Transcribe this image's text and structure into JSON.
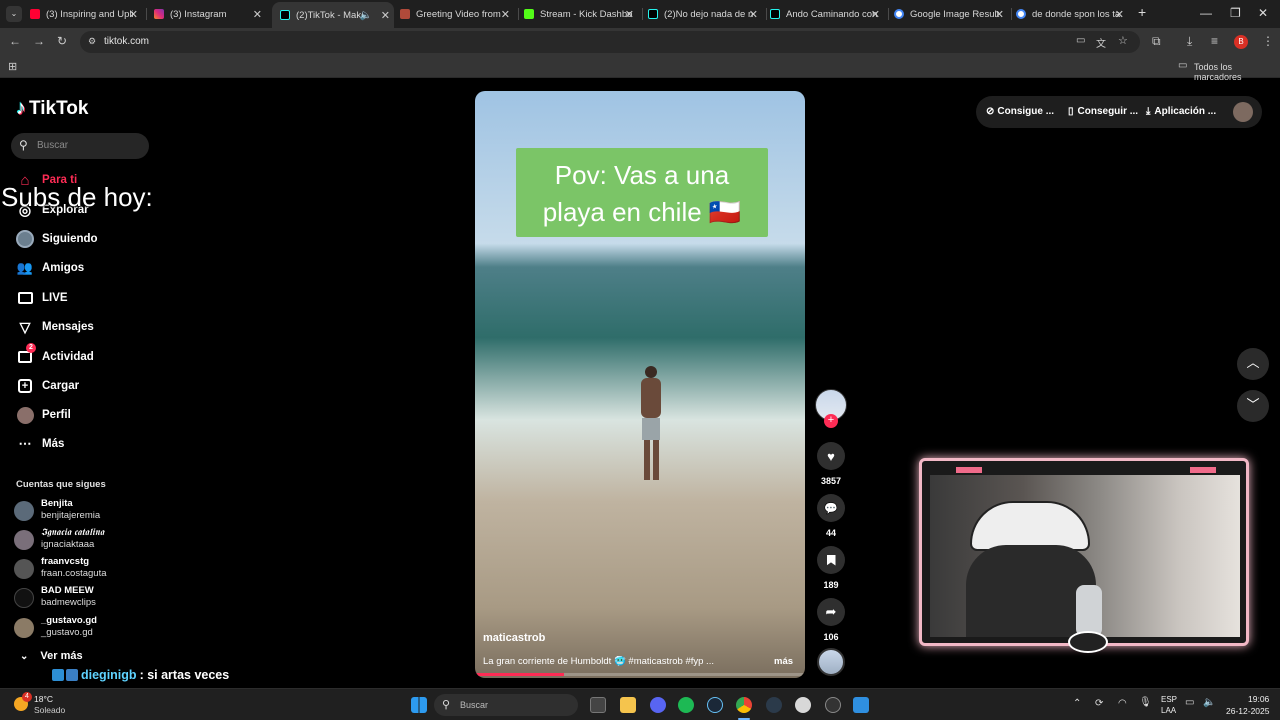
{
  "browser": {
    "tabs": [
      {
        "title": "(3) Inspiring and Upli",
        "color": "#ff0033"
      },
      {
        "title": "(3) Instagram",
        "color": "#d6249f"
      },
      {
        "title": "(2)TikTok - Make",
        "color": "#25f4ee",
        "active": true
      },
      {
        "title": "Greeting Video from",
        "color": "#b04a3a"
      },
      {
        "title": "Stream - Kick Dashbo",
        "color": "#53fc18"
      },
      {
        "title": "(2)No dejo nada de n",
        "color": "#25f4ee"
      },
      {
        "title": "Ando Caminando con",
        "color": "#25f4ee"
      },
      {
        "title": "Google Image Result",
        "color": "#4285f4"
      },
      {
        "title": "de donde spon los ta",
        "color": "#4285f4"
      }
    ],
    "url": "tiktok.com",
    "bookmarks_label": "Todos los marcadores",
    "profile_initial": "B"
  },
  "overlay": {
    "subs_text": "Subs de hoy:",
    "chat_user": "dieginigb",
    "chat_message": ": si artas veces"
  },
  "tiktok": {
    "logo": "TikTok",
    "search_placeholder": "Buscar",
    "nav": [
      {
        "label": "Para ti",
        "icon": "home-icon"
      },
      {
        "label": "Explorar",
        "icon": "compass-icon"
      },
      {
        "label": "Siguiendo",
        "icon": "following-icon"
      },
      {
        "label": "Amigos",
        "icon": "friends-icon"
      },
      {
        "label": "LIVE",
        "icon": "live-icon"
      },
      {
        "label": "Mensajes",
        "icon": "send-icon"
      },
      {
        "label": "Actividad",
        "icon": "activity-icon",
        "badge": "2"
      },
      {
        "label": "Cargar",
        "icon": "upload-icon"
      },
      {
        "label": "Perfil",
        "icon": "profile-icon"
      },
      {
        "label": "Más",
        "icon": "more-icon"
      }
    ],
    "following_header": "Cuentas que sigues",
    "accounts": [
      {
        "name": "Benjita",
        "handle": "benjitajeremia"
      },
      {
        "name": "𝕴𝖌𝖓𝖆𝖈𝖎𝖆 𝖈𝖆𝖙𝖆𝖑𝖎𝖓𝖆",
        "handle": "ignaciaktaaa"
      },
      {
        "name": "fraanvcstg",
        "handle": "fraan.costaguta"
      },
      {
        "name": "BAD MEEW",
        "handle": "badmewclips"
      },
      {
        "name": "_gustavo.gd",
        "handle": "_gustavo.gd"
      }
    ],
    "see_more": "Ver más",
    "top_buttons": [
      "Consigue ...",
      "Conseguir ...",
      "Aplicación ..."
    ],
    "video": {
      "caption_overlay": "Pov: Vas a una playa en chile 🇨🇱",
      "author": "maticastrob",
      "description": "La gran corriente de Humboldt 🥶 #maticastrob #fyp ...",
      "more": "más"
    },
    "actions": {
      "likes": "3857",
      "comments": "44",
      "saves": "189",
      "shares": "106"
    }
  },
  "taskbar": {
    "weather_temp": "18°C",
    "weather_desc": "Soleado",
    "weather_badge": "4",
    "search_placeholder": "Buscar",
    "lang_1": "ESP",
    "lang_2": "LAA",
    "time": "19:06",
    "date": "26-12-2025"
  }
}
